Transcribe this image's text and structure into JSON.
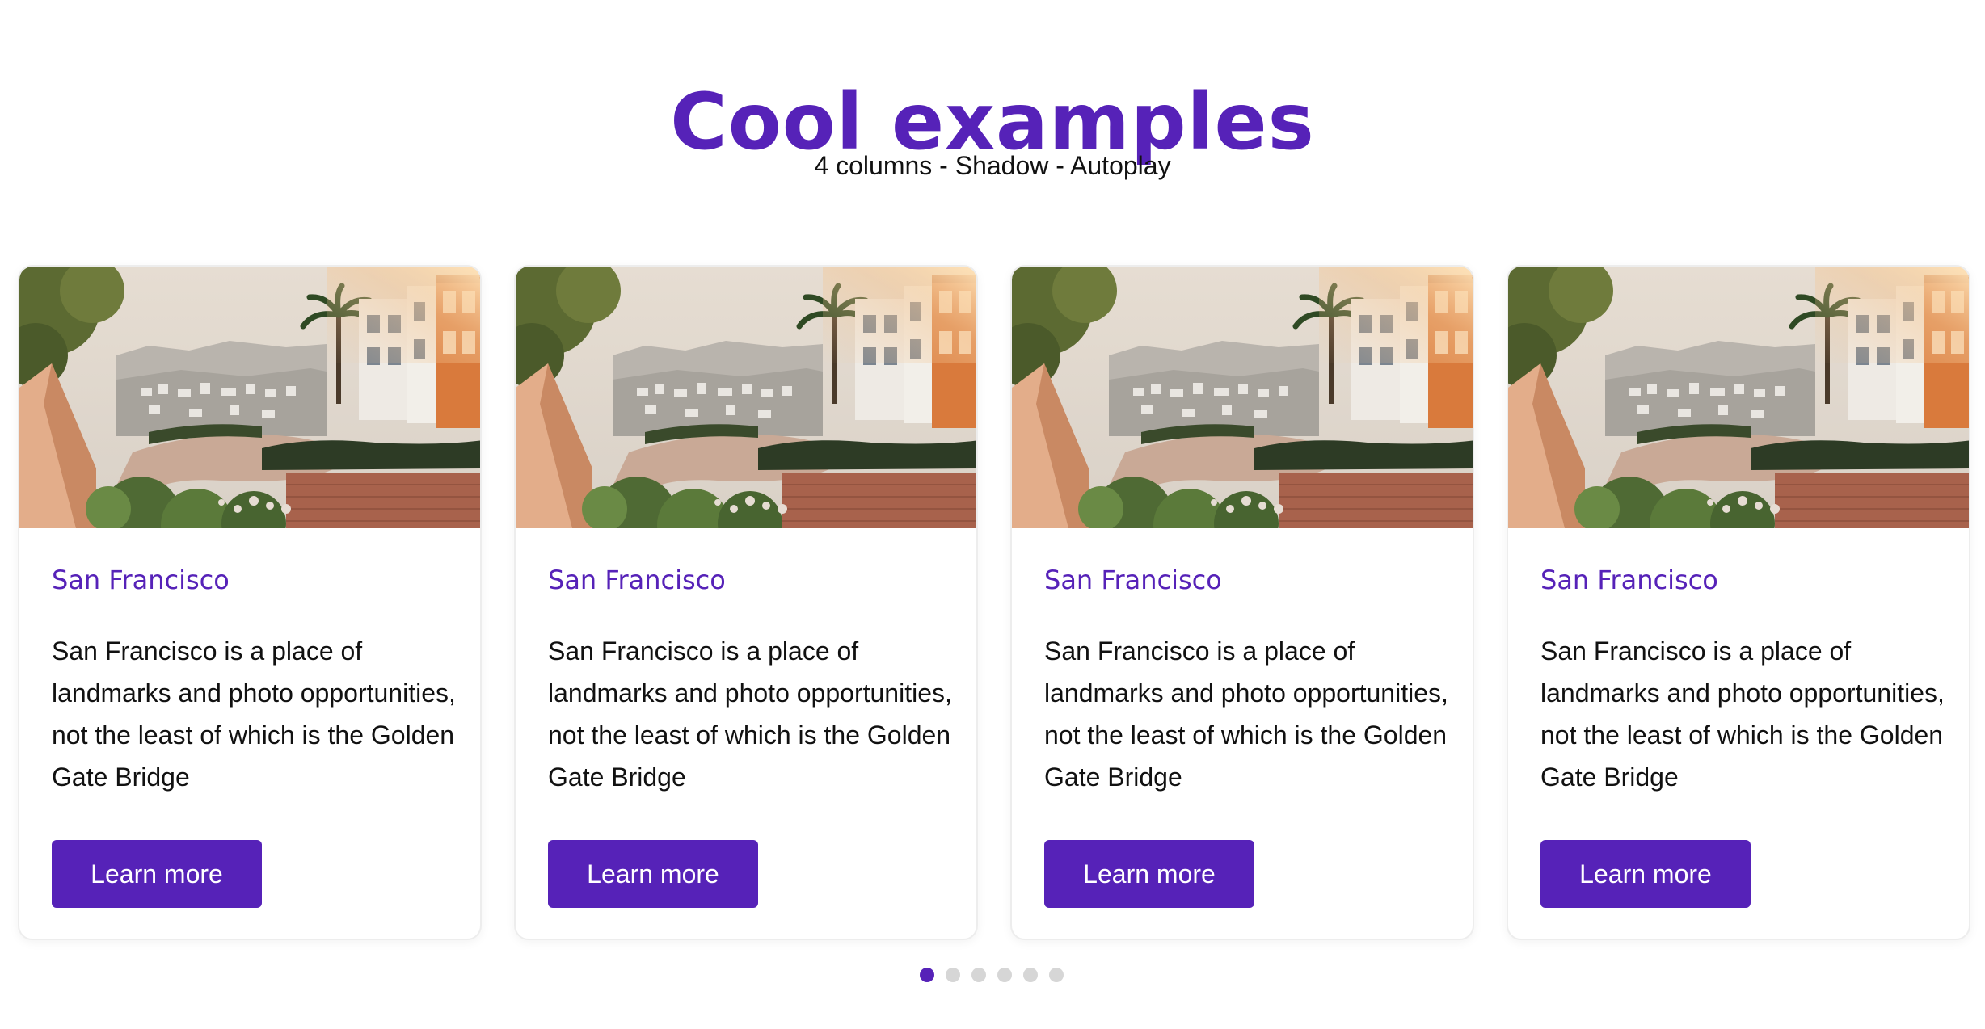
{
  "header": {
    "title": "Cool examples",
    "subtitle": "4 columns - Shadow - Autoplay"
  },
  "theme": {
    "accent": "#5622b8",
    "dot_inactive": "#d6d6d6",
    "card_border": "#ededed"
  },
  "cards": [
    {
      "image": "san-francisco-lombard-street-photo",
      "title": "San Francisco",
      "text": "San Francisco is a place of landmarks and photo opportunities, not the least of which is the Golden Gate Bridge",
      "button_label": "Learn more"
    },
    {
      "image": "san-francisco-lombard-street-photo",
      "title": "San Francisco",
      "text": "San Francisco is a place of landmarks and photo opportunities, not the least of which is the Golden Gate Bridge",
      "button_label": "Learn more"
    },
    {
      "image": "san-francisco-lombard-street-photo",
      "title": "San Francisco",
      "text": "San Francisco is a place of landmarks and photo opportunities, not the least of which is the Golden Gate Bridge",
      "button_label": "Learn more"
    },
    {
      "image": "san-francisco-lombard-street-photo",
      "title": "San Francisco",
      "text": "San Francisco is a place of landmarks and photo opportunities, not the least of which is the Golden Gate Bridge",
      "button_label": "Learn more"
    }
  ],
  "pagination": {
    "total": 6,
    "active_index": 0
  }
}
